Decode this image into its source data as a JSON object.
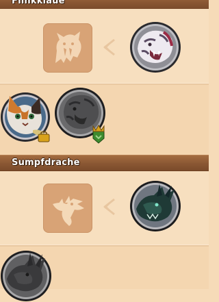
{
  "sections": [
    {
      "title": "Flinkklaue",
      "target_creature": "white-tiger-creature",
      "unlock_silhouette": "saber-cat-silhouette-icon"
    },
    {
      "title": "Sumpfdrache",
      "target_creature": "swamp-dragon-creature",
      "unlock_silhouette": "dragon-head-silhouette-icon"
    }
  ],
  "requirements_row_1": [
    "calico-cat-creature",
    "grey-cat-creature-locked"
  ],
  "requirements_row_2": [
    "grey-dragon-creature-locked"
  ],
  "colors": {
    "header": "#8a5733",
    "panel": "#f6dbb8",
    "placeholder": "#d8a376",
    "badge_green": "#3d8b2e",
    "badge_gold": "#d8a21c"
  }
}
